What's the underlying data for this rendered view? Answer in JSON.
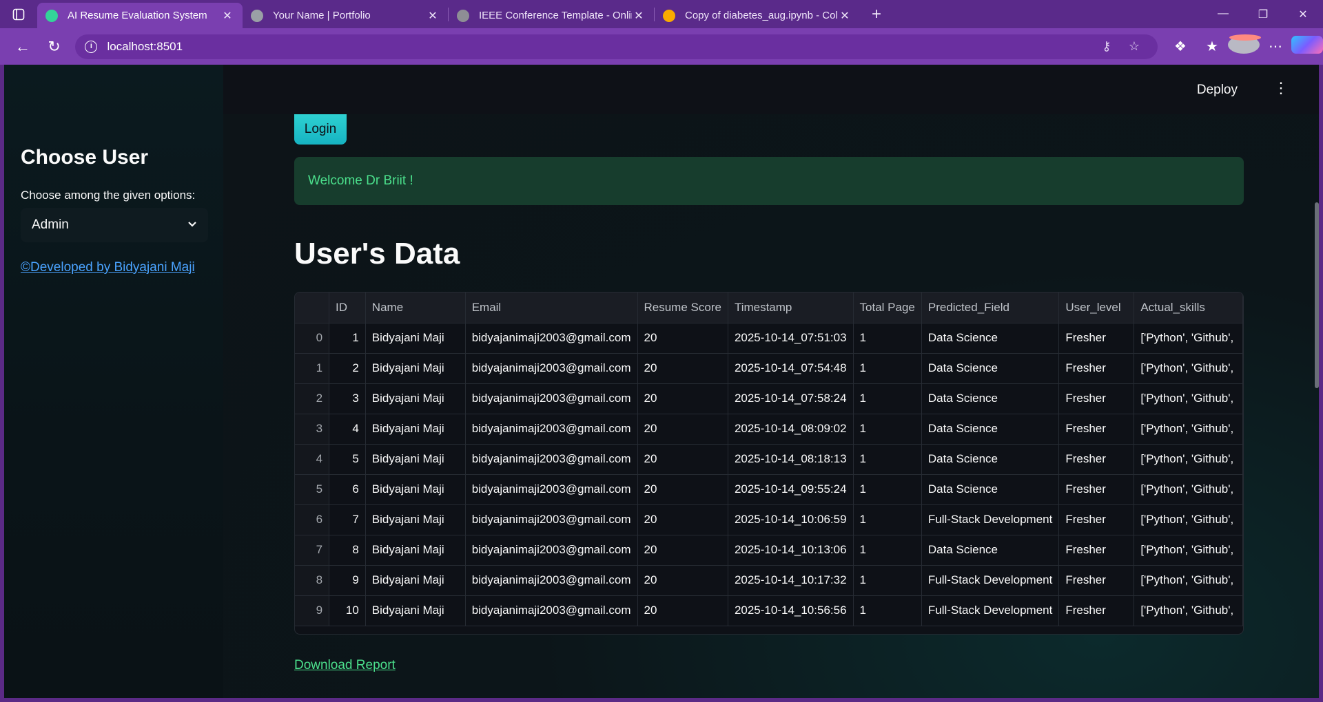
{
  "browser": {
    "tabs": [
      {
        "title": "AI Resume Evaluation System",
        "active": true,
        "favicon_color": "#34d399"
      },
      {
        "title": "Your Name | Portfolio",
        "active": false,
        "favicon_color": "#9aa0a6"
      },
      {
        "title": "IEEE Conference Template - Online",
        "active": false,
        "favicon_color": "#8e8e95"
      },
      {
        "title": "Copy of diabetes_aug.ipynb - Cola",
        "active": false,
        "favicon_color": "#f9ab00"
      }
    ],
    "url": "localhost:8501"
  },
  "header": {
    "deploy_label": "Deploy"
  },
  "sidebar": {
    "title": "Choose User",
    "select_label": "Choose among the given options:",
    "selected_value": "Admin",
    "developer_link": "©Developed by Bidyajani Maji"
  },
  "main": {
    "login_label": "Login",
    "welcome_message": "Welcome Dr Briit !",
    "section_title": "User's Data",
    "download_label": "Download Report",
    "table": {
      "columns": [
        "",
        "ID",
        "Name",
        "Email",
        "Resume Score",
        "Timestamp",
        "Total Page",
        "Predicted_Field",
        "User_level",
        "Actual_skills"
      ],
      "rows": [
        [
          "0",
          "1",
          "Bidyajani Maji",
          "bidyajanimaji2003@gmail.com",
          "20",
          "2025-10-14_07:51:03",
          "1",
          "Data Science",
          "Fresher",
          "['Python', 'Github',"
        ],
        [
          "1",
          "2",
          "Bidyajani Maji",
          "bidyajanimaji2003@gmail.com",
          "20",
          "2025-10-14_07:54:48",
          "1",
          "Data Science",
          "Fresher",
          "['Python', 'Github',"
        ],
        [
          "2",
          "3",
          "Bidyajani Maji",
          "bidyajanimaji2003@gmail.com",
          "20",
          "2025-10-14_07:58:24",
          "1",
          "Data Science",
          "Fresher",
          "['Python', 'Github',"
        ],
        [
          "3",
          "4",
          "Bidyajani Maji",
          "bidyajanimaji2003@gmail.com",
          "20",
          "2025-10-14_08:09:02",
          "1",
          "Data Science",
          "Fresher",
          "['Python', 'Github',"
        ],
        [
          "4",
          "5",
          "Bidyajani Maji",
          "bidyajanimaji2003@gmail.com",
          "20",
          "2025-10-14_08:18:13",
          "1",
          "Data Science",
          "Fresher",
          "['Python', 'Github',"
        ],
        [
          "5",
          "6",
          "Bidyajani Maji",
          "bidyajanimaji2003@gmail.com",
          "20",
          "2025-10-14_09:55:24",
          "1",
          "Data Science",
          "Fresher",
          "['Python', 'Github',"
        ],
        [
          "6",
          "7",
          "Bidyajani Maji",
          "bidyajanimaji2003@gmail.com",
          "20",
          "2025-10-14_10:06:59",
          "1",
          "Full-Stack Development",
          "Fresher",
          "['Python', 'Github',"
        ],
        [
          "7",
          "8",
          "Bidyajani Maji",
          "bidyajanimaji2003@gmail.com",
          "20",
          "2025-10-14_10:13:06",
          "1",
          "Data Science",
          "Fresher",
          "['Python', 'Github',"
        ],
        [
          "8",
          "9",
          "Bidyajani Maji",
          "bidyajanimaji2003@gmail.com",
          "20",
          "2025-10-14_10:17:32",
          "1",
          "Full-Stack Development",
          "Fresher",
          "['Python', 'Github',"
        ],
        [
          "9",
          "10",
          "Bidyajani Maji",
          "bidyajanimaji2003@gmail.com",
          "20",
          "2025-10-14_10:56:56",
          "1",
          "Full-Stack Development",
          "Fresher",
          "['Python', 'Github',"
        ]
      ]
    }
  }
}
